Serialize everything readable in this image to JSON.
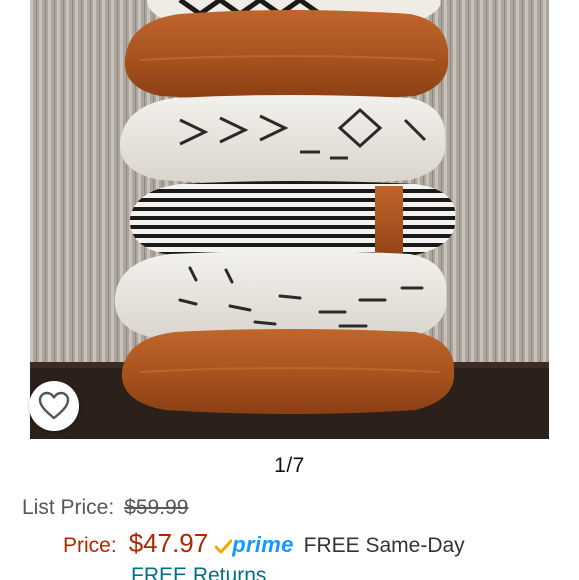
{
  "product": {
    "image_description_icon": "pillow-stack-photo",
    "image_counter": "1/7",
    "wishlist_icon": "heart-outline-icon"
  },
  "pricing": {
    "list_price_label": "List Price:",
    "list_price_value": "$59.99",
    "price_label": "Price:",
    "price_value": "$47.97",
    "prime_label": "prime",
    "delivery_text": "FREE Same-Day",
    "returns_text": "FREE Returns"
  },
  "colors": {
    "price_red": "#b12704",
    "prime_blue": "#1399ff",
    "prime_check_orange": "#f7a600",
    "link_teal": "#007185"
  }
}
